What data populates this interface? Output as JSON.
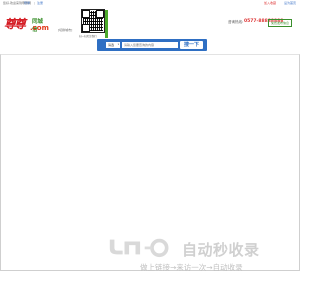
{
  "topbar": {
    "greeting": "您好,欢迎来到尊尊网",
    "login": "登录",
    "separator": "|",
    "register": "注册",
    "favorite": "加入收藏",
    "homepage": "设为首页"
  },
  "header": {
    "logo_text": "尊尊",
    "logo_brand": "同城信",
    "logo_domain": ".com",
    "city_switch": "[切换城市]",
    "qr_caption": "扫一扫关注我们",
    "hotline_label": "咨询热线:",
    "hotline_number": "0577-88888888",
    "free_post": "免费发布信息"
  },
  "search": {
    "category": "请选",
    "placeholder": "请输入您要查询的内容",
    "button": "搜一下"
  },
  "watermark": {
    "title": "自动秒收录",
    "subtitle": "做上链接→来访一次→自动收录"
  },
  "colors": {
    "accent_blue": "#2f6fc3",
    "brand_green": "#4caa2b",
    "brand_red": "#d51d24"
  }
}
